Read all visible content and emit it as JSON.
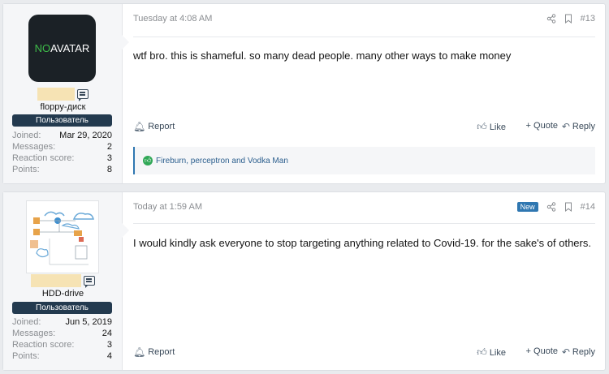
{
  "posts": [
    {
      "avatar_text_a": "NO",
      "avatar_text_b": "AVATAR",
      "username": "floppy-диск",
      "role": "Пользователь",
      "stats": [
        {
          "k": "Joined:",
          "v": "Mar 29, 2020"
        },
        {
          "k": "Messages:",
          "v": "2"
        },
        {
          "k": "Reaction score:",
          "v": "3"
        },
        {
          "k": "Points:",
          "v": "8"
        }
      ],
      "time": "Tuesday at 4:08 AM",
      "number": "#13",
      "body": "wtf bro. this is shameful. so many dead people. many other ways to make money",
      "actions": {
        "report": "Report",
        "like": "Like",
        "quote": "+ Quote",
        "reply": "Reply"
      },
      "reactions": "Fireburn, perceptron and Vodka Man"
    },
    {
      "username": "HDD-drive",
      "role": "Пользователь",
      "stats": [
        {
          "k": "Joined:",
          "v": "Jun 5, 2019"
        },
        {
          "k": "Messages:",
          "v": "24"
        },
        {
          "k": "Reaction score:",
          "v": "3"
        },
        {
          "k": "Points:",
          "v": "4"
        }
      ],
      "time": "Today at 1:59 AM",
      "badge": "New",
      "number": "#14",
      "body": "I would kindly ask everyone to stop targeting anything related to Covid-19. for the sake's of others.",
      "actions": {
        "report": "Report",
        "like": "Like",
        "quote": "+ Quote",
        "reply": "Reply"
      }
    }
  ],
  "icons": {
    "share": "share-icon",
    "bookmark": "bookmark-icon",
    "report": "bell-icon",
    "like": "thumbs-up-icon",
    "reply": "reply-arrow-icon",
    "message": "message-icon"
  }
}
